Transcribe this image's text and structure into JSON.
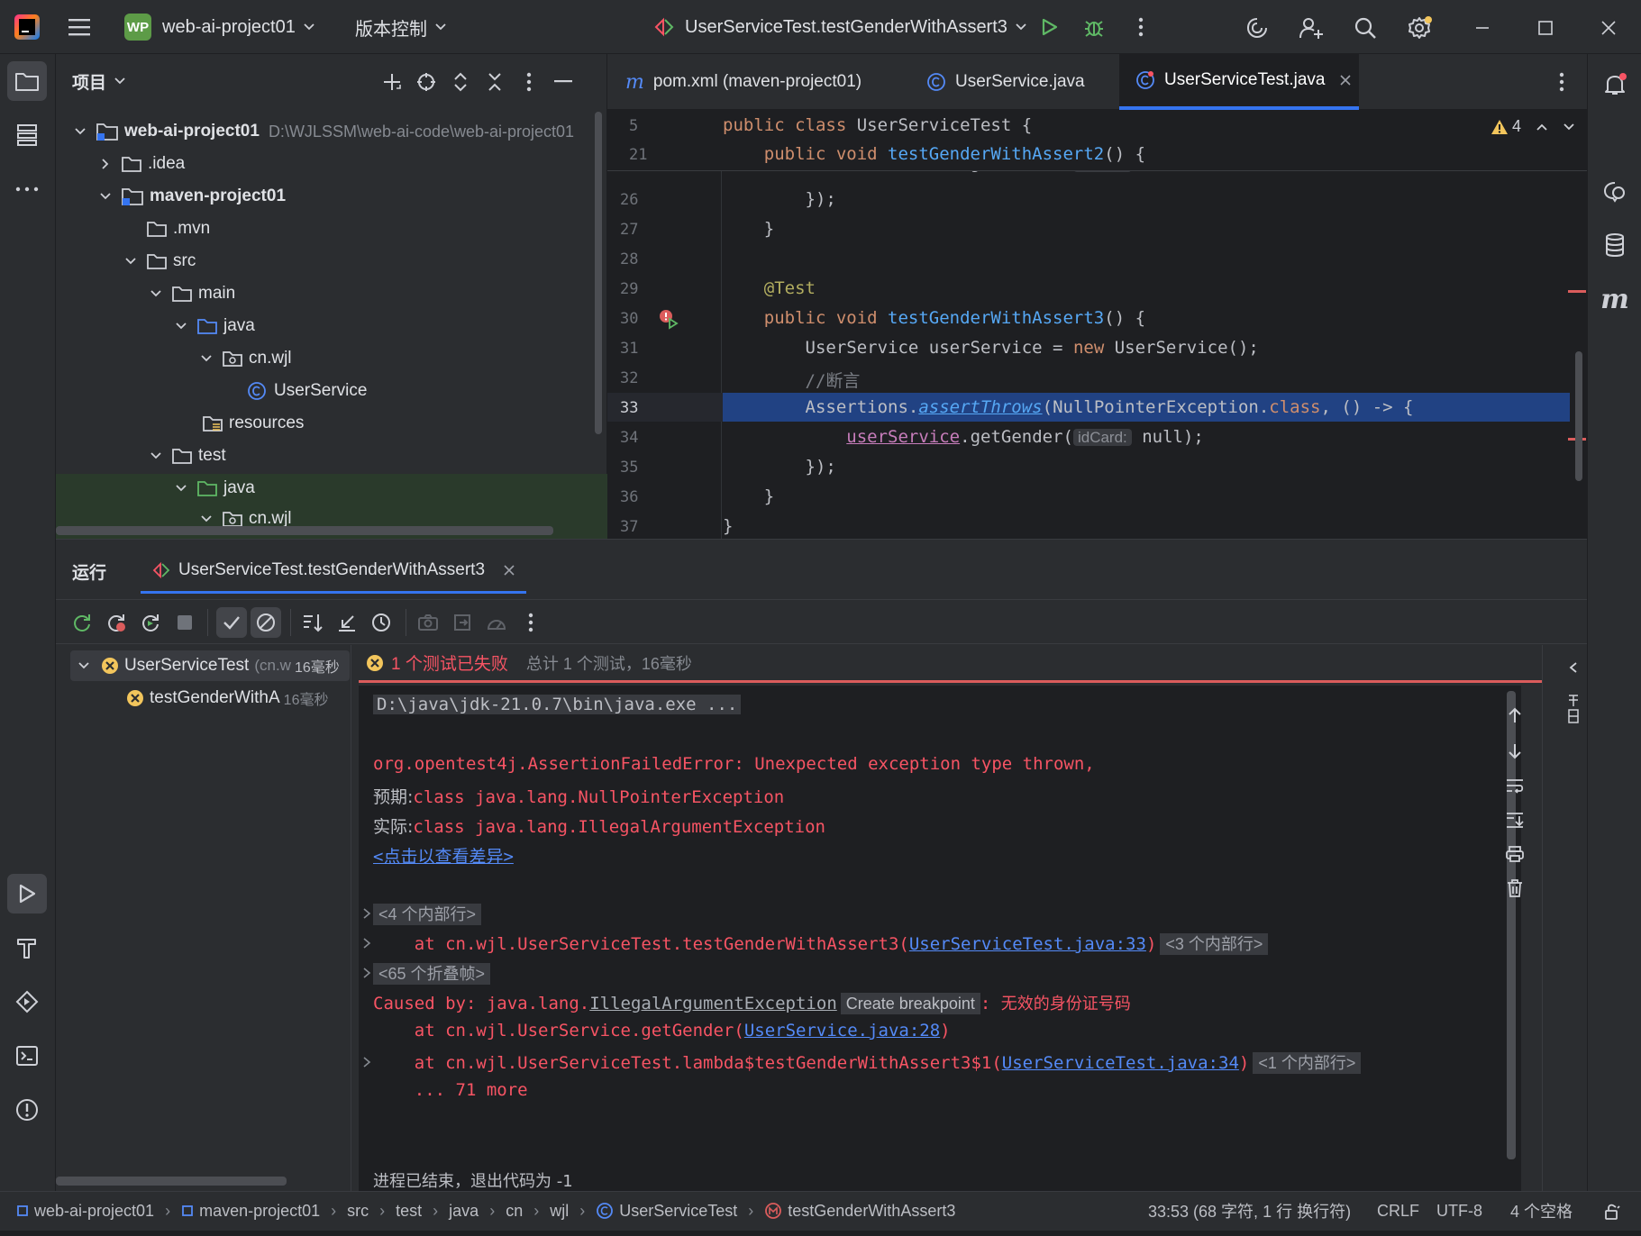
{
  "topbar": {
    "project_badge": "WP",
    "project_name": "web-ai-project01",
    "vcs_label": "版本控制",
    "run_config": "UserServiceTest.testGenderWithAssert3"
  },
  "project_panel": {
    "title": "项目",
    "tree": [
      {
        "label": "web-ai-project01",
        "path": "D:\\WJLSSM\\web-ai-code\\web-ai-project01",
        "bold": true
      },
      {
        "label": ".idea"
      },
      {
        "label": "maven-project01",
        "bold": true
      },
      {
        "label": ".mvn"
      },
      {
        "label": "src"
      },
      {
        "label": "main"
      },
      {
        "label": "java"
      },
      {
        "label": "cn.wjl"
      },
      {
        "label": "UserService"
      },
      {
        "label": "resources"
      },
      {
        "label": "test"
      },
      {
        "label": "java"
      },
      {
        "label": "cn.wjl"
      }
    ]
  },
  "editor": {
    "tabs": [
      {
        "label": "pom.xml (maven-project01)"
      },
      {
        "label": "UserService.java"
      },
      {
        "label": "UserServiceTest.java"
      }
    ],
    "warning_count": "4",
    "sticky": [
      {
        "ln": "5",
        "a": "public class ",
        "b": "UserServiceTest {"
      },
      {
        "ln": "21",
        "a": "    public void ",
        "b": "testGenderWithAssert2",
        "c": "() {"
      }
    ],
    "lines": {
      "l26": "26",
      "l26_code": "        });",
      "l27": "27",
      "l27_code": "    }",
      "l28": "28",
      "l29": "29",
      "l29_code": "    @Test",
      "l30": "30",
      "l30_kw": "    public void ",
      "l30_fn": "testGenderWithAssert3",
      "l30_rest": "() {",
      "l31": "31",
      "l31_a": "        UserService userService = ",
      "l31_kw": "new",
      "l31_b": " UserService();",
      "l32": "32",
      "l32_code": "        //断言",
      "l33": "33",
      "l33_a": "        Assertions.",
      "l33_fn": "assertThrows",
      "l33_b": "(NullPointerException.",
      "l33_kw": "class",
      "l33_c": ", () -> {",
      "l34": "34",
      "l34_a": "            ",
      "l34_fld": "userService",
      "l34_b": ".getGender(",
      "l34_hint": "idCard:",
      "l34_c": " null);",
      "l35": "35",
      "l35_code": "        });",
      "l36": "36",
      "l36_code": "    }",
      "l37": "37",
      "l37_code": "}"
    }
  },
  "run_panel": {
    "title": "运行",
    "tab_label": "UserServiceTest.testGenderWithAssert3",
    "tree": [
      {
        "label": "UserServiceTest",
        "sub": "(cn.w",
        "time": "16毫秒"
      },
      {
        "label": "testGenderWithA",
        "time": "16毫秒"
      }
    ],
    "status_fail": "1 个测试已失败",
    "status_total": "总计 1 个测试，16毫秒",
    "console": {
      "cmd": "D:\\java\\jdk-21.0.7\\bin\\java.exe ...",
      "err1": "org.opentest4j.AssertionFailedError: Unexpected exception type thrown,",
      "exp_label": "预期:",
      "exp_val": "class java.lang.NullPointerException",
      "act_label": "实际:",
      "act_val": "class java.lang.IllegalArgumentException",
      "diff_link": "<点击以查看差异>",
      "fold1": "<4 个内部行>",
      "at1_a": "    at cn.wjl.UserServiceTest.testGenderWithAssert3(",
      "at1_link": "UserServiceTest.java:33",
      "at1_b": ")",
      "fold2": "<3 个内部行>",
      "fold3": "<65 个折叠帧>",
      "caused_a": "Caused by: java.lang.",
      "caused_link": "IllegalArgumentException",
      "create_bp": "Create breakpoint",
      "caused_b": ": ",
      "caused_msg": "无效的身份证号码",
      "at2_a": "    at cn.wjl.UserService.getGender(",
      "at2_link": "UserService.java:28",
      "at2_b": ")",
      "at3_a": "    at cn.wjl.UserServiceTest.lambda$testGenderWithAssert3$1(",
      "at3_link": "UserServiceTest.java:34",
      "at3_b": ")",
      "fold4": "<1 个内部行>",
      "more": "    ... 71 more",
      "exit": "进程已结束，退出代码为 -1"
    }
  },
  "statusbar": {
    "crumbs": [
      "web-ai-project01",
      "maven-project01",
      "src",
      "test",
      "java",
      "cn",
      "wjl",
      "UserServiceTest",
      "testGenderWithAssert3"
    ],
    "position": "33:53 (68 字符, 1 行 换行符)",
    "line_sep": "CRLF",
    "encoding": "UTF-8",
    "indent": "4 个空格"
  },
  "colors": {
    "accent": "#3574f0",
    "error": "#f75464",
    "selection": "#214283",
    "run_green": "#5fb865"
  }
}
